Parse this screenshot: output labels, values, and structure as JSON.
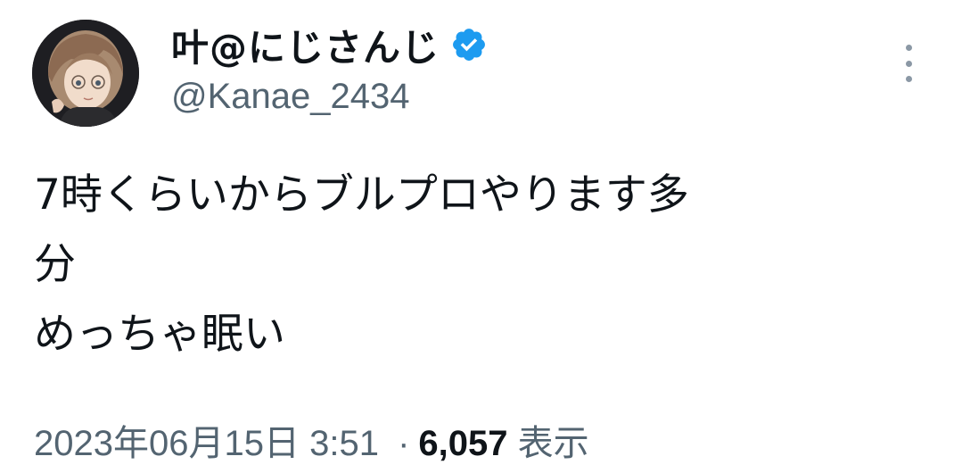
{
  "author": {
    "display_name": "叶@にじさんじ",
    "handle": "@Kanae_2434",
    "verified": true,
    "verified_color": "#1d9bf0"
  },
  "tweet": {
    "lines": [
      "7時くらいからブルプロやります多",
      "分",
      "めっちゃ眠い"
    ]
  },
  "meta": {
    "date": "2023年06月15日",
    "time": "3:51",
    "separator": "·",
    "views_count": "6,057",
    "views_label": "表示"
  },
  "icons": {
    "avatar": "avatar",
    "verified": "verified-badge-icon",
    "more": "more-vertical-icon"
  }
}
